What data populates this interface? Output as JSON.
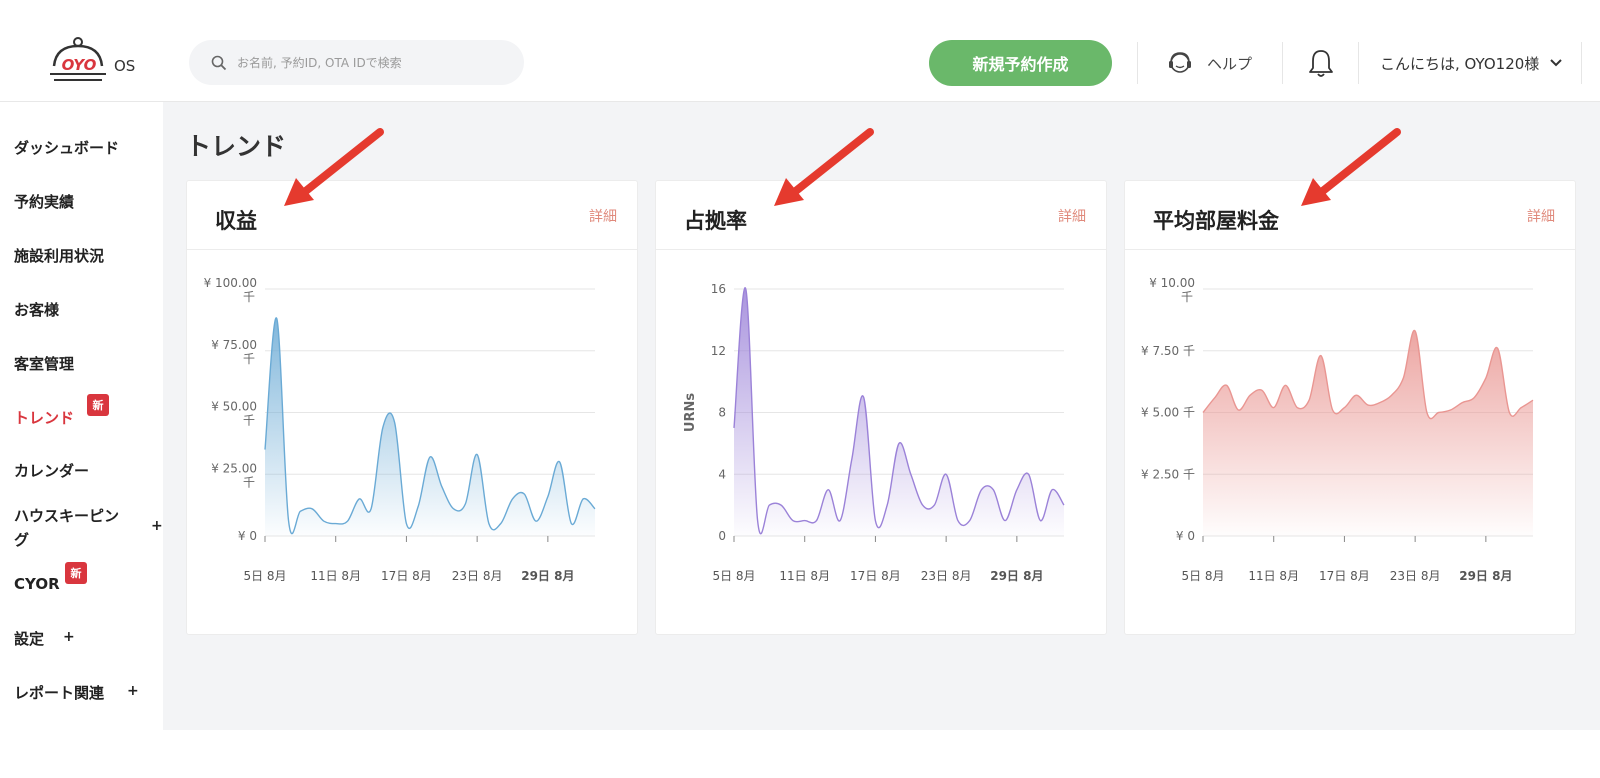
{
  "header": {
    "logo_text": "OYO",
    "logo_suffix": "OS",
    "search_placeholder": "お名前, 予約ID, OTA IDで検索",
    "new_booking_label": "新規予約作成",
    "help_label": "ヘルプ",
    "user_greeting": "こんにちは, OYO120様",
    "brand_green": "#6ab86a"
  },
  "sidebar": {
    "items": [
      {
        "label": "ダッシュボード"
      },
      {
        "label": "予約実績"
      },
      {
        "label": "施設利用状況"
      },
      {
        "label": "お客様"
      },
      {
        "label": "客室管理"
      },
      {
        "label": "トレンド",
        "badge": "新",
        "active": true
      },
      {
        "label": "カレンダー"
      },
      {
        "label": "ハウスキーピン",
        "label2": "グ",
        "plus": "+"
      },
      {
        "label": "CYOR",
        "badge": "新"
      },
      {
        "label": "設定",
        "plus": "+"
      },
      {
        "label": "レポート関連",
        "plus": "+"
      }
    ]
  },
  "page_title": "トレンド",
  "cards": [
    {
      "title": "収益",
      "detail": "詳細"
    },
    {
      "title": "占拠率",
      "detail": "詳細"
    },
    {
      "title": "平均部屋料金",
      "detail": "詳細"
    }
  ],
  "chart_data": [
    {
      "type": "area",
      "title": "収益",
      "color": "#6aaad5",
      "x_ticks": [
        "5日 8月",
        "11日 8月",
        "17日 8月",
        "23日 8月",
        "29日 8月"
      ],
      "x_tick_index": [
        0,
        6,
        12,
        18,
        24
      ],
      "ylim": [
        0,
        100
      ],
      "y_ticks": [
        {
          "v": 0,
          "label": "¥ 0",
          "label2": ""
        },
        {
          "v": 25,
          "label": "¥ 25.00",
          "label2": "千"
        },
        {
          "v": 50,
          "label": "¥ 50.00",
          "label2": "千"
        },
        {
          "v": 75,
          "label": "¥ 75.00",
          "label2": "千"
        },
        {
          "v": 100,
          "label": "¥ 100.00",
          "label2": "千"
        }
      ],
      "ylabel": "",
      "values": [
        35,
        88,
        6,
        10,
        11,
        6,
        5,
        6,
        15,
        11,
        44,
        46,
        5,
        12,
        32,
        20,
        11,
        13,
        33,
        5,
        5,
        15,
        17,
        6,
        16,
        30,
        5,
        15,
        11
      ]
    },
    {
      "type": "area",
      "title": "占拠率",
      "color": "#9b82d8",
      "x_ticks": [
        "5日 8月",
        "11日 8月",
        "17日 8月",
        "23日 8月",
        "29日 8月"
      ],
      "x_tick_index": [
        0,
        6,
        12,
        18,
        24
      ],
      "ylim": [
        0,
        16
      ],
      "y_ticks": [
        {
          "v": 0,
          "label": "0",
          "label2": ""
        },
        {
          "v": 4,
          "label": "4",
          "label2": ""
        },
        {
          "v": 8,
          "label": "8",
          "label2": ""
        },
        {
          "v": 12,
          "label": "12",
          "label2": ""
        },
        {
          "v": 16,
          "label": "16",
          "label2": ""
        }
      ],
      "ylabel": "URNs",
      "values": [
        7,
        16,
        1,
        2,
        2,
        1,
        1,
        1,
        3,
        1,
        5,
        9,
        1,
        2,
        6,
        4,
        2,
        2,
        4,
        1,
        1,
        3,
        3,
        1,
        3,
        4,
        1,
        3,
        2
      ]
    },
    {
      "type": "area",
      "title": "平均部屋料金",
      "color": "#e99692",
      "x_ticks": [
        "5日 8月",
        "11日 8月",
        "17日 8月",
        "23日 8月",
        "29日 8月"
      ],
      "x_tick_index": [
        0,
        6,
        12,
        18,
        24
      ],
      "ylim": [
        0,
        10
      ],
      "y_ticks": [
        {
          "v": 0,
          "label": "¥ 0",
          "label2": ""
        },
        {
          "v": 2.5,
          "label": "¥ 2.50 千",
          "label2": ""
        },
        {
          "v": 5,
          "label": "¥ 5.00 千",
          "label2": ""
        },
        {
          "v": 7.5,
          "label": "¥ 7.50 千",
          "label2": ""
        },
        {
          "v": 10,
          "label": "¥ 10.00",
          "label2": "千"
        }
      ],
      "ylabel": "",
      "values": [
        5.0,
        5.6,
        6.1,
        5.1,
        5.7,
        5.9,
        5.2,
        6.1,
        5.2,
        5.5,
        7.3,
        5.1,
        5.2,
        5.7,
        5.3,
        5.4,
        5.7,
        6.4,
        8.3,
        5.0,
        5.0,
        5.1,
        5.4,
        5.6,
        6.4,
        7.6,
        5.0,
        5.2,
        5.5
      ]
    }
  ]
}
